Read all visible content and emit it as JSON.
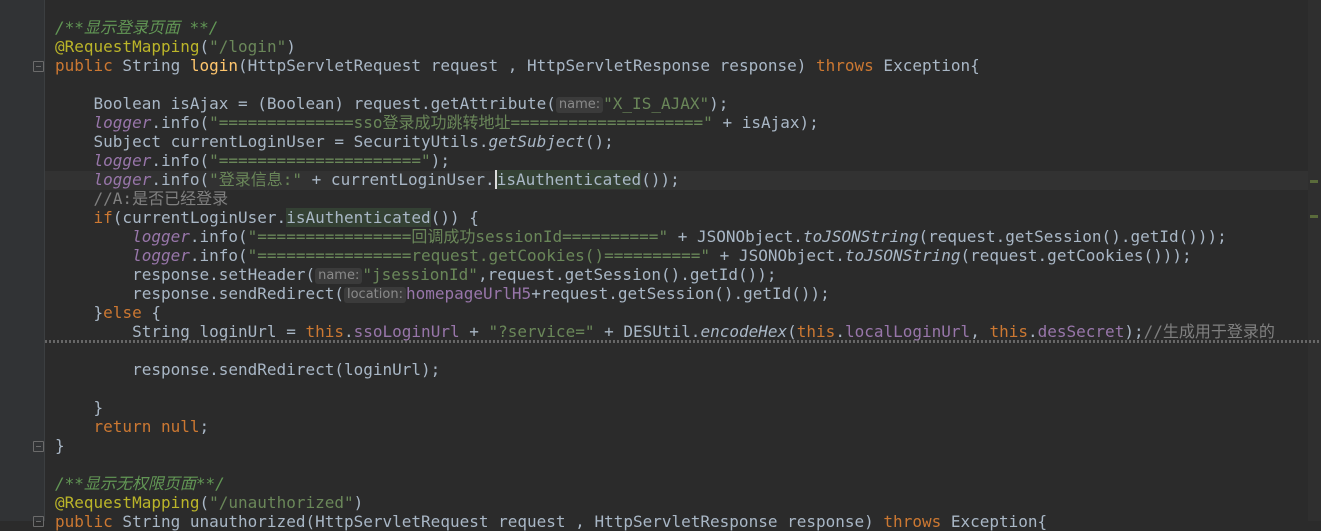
{
  "editor": {
    "lines": {
      "l1_doc": "/**显示登录页面 **/",
      "l2_ann": "@RequestMapping",
      "l2_open": "(",
      "l2_str": "\"/login\"",
      "l2_close": ")",
      "l3_kw1": "public",
      "l3_a": " String ",
      "l3_method": "login",
      "l3_b": "(HttpServletRequest request , HttpServletResponse response) ",
      "l3_kw2": "throws",
      "l3_c": " Exception{",
      "l5_a": "    Boolean isAjax = (Boolean) request.getAttribute(",
      "l5_hint": "name:",
      "l5_str": "\"X_IS_AJAX\"",
      "l5_b": ");",
      "l6_logger": "logger",
      "l6_a": ".info(",
      "l6_str": "\"==============sso登录成功跳转地址====================\"",
      "l6_b": " + isAjax);",
      "l7_a": "    Subject currentLoginUser = SecurityUtils.",
      "l7_stat": "getSubject",
      "l7_b": "();",
      "l8_logger": "logger",
      "l8_a": ".info(",
      "l8_str": "\"=====================\"",
      "l8_b": ");",
      "l9_logger": "logger",
      "l9_a": ".info(",
      "l9_str": "\"登录信息:\"",
      "l9_b": " + currentLoginUser.",
      "l9_c": "isAuthenticated",
      "l9_d": "());",
      "l10_cmt": "    //A:是否已经登录",
      "l11_kw": "    if",
      "l11_a": "(currentLoginUser.",
      "l11_b": "isAuthenticated",
      "l11_c": "()) {",
      "l12_logger": "logger",
      "l12_a": ".info(",
      "l12_str": "\"================回调成功sessionId==========\"",
      "l12_b": " + JSONObject.",
      "l12_stat": "toJSONString",
      "l12_c": "(request.getSession().getId()));",
      "l13_logger": "logger",
      "l13_a": ".info(",
      "l13_str": "\"================request.getCookies()==========\"",
      "l13_b": " + JSONObject.",
      "l13_stat": "toJSONString",
      "l13_c": "(request.getCookies()));",
      "l14_a": "        response.setHeader(",
      "l14_hint": "name:",
      "l14_str": "\"jsessionId\"",
      "l14_b": ",request.getSession().getId());",
      "l15_a": "        response.sendRedirect(",
      "l15_hint": "location:",
      "l15_fld": "homepageUrlH5",
      "l15_b": "+request.getSession().getId());",
      "l16_a": "    }",
      "l16_kw": "else",
      "l16_b": " {",
      "l17_a": "        String loginUrl = ",
      "l17_kw1": "this",
      "l17_b": ".",
      "l17_fld1": "ssoLoginUrl",
      "l17_c": " + ",
      "l17_str": "\"?service=\"",
      "l17_d": " + DESUtil.",
      "l17_stat": "encodeHex",
      "l17_e": "(",
      "l17_kw2": "this",
      "l17_f": ".",
      "l17_fld2": "localLoginUrl",
      "l17_g": ", ",
      "l17_kw3": "this",
      "l17_h": ".",
      "l17_fld3": "desSecret",
      "l17_i": ");",
      "l17_cmt": "//生成用于登录的",
      "l19": "        response.sendRedirect(loginUrl);",
      "l21": "    }",
      "l22_kw": "    return null",
      "l22_b": ";",
      "l23": "}",
      "l25_doc": "/**显示无权限页面**/",
      "l26_ann": "@RequestMapping",
      "l26_open": "(",
      "l26_str": "\"/unauthorized\"",
      "l26_close": ")",
      "l27_kw1": "public",
      "l27_a": " String unauthorized(HttpServletRequest request , HttpServletResponse response) ",
      "l27_kw2": "throws",
      "l27_c": " Exception{"
    }
  }
}
